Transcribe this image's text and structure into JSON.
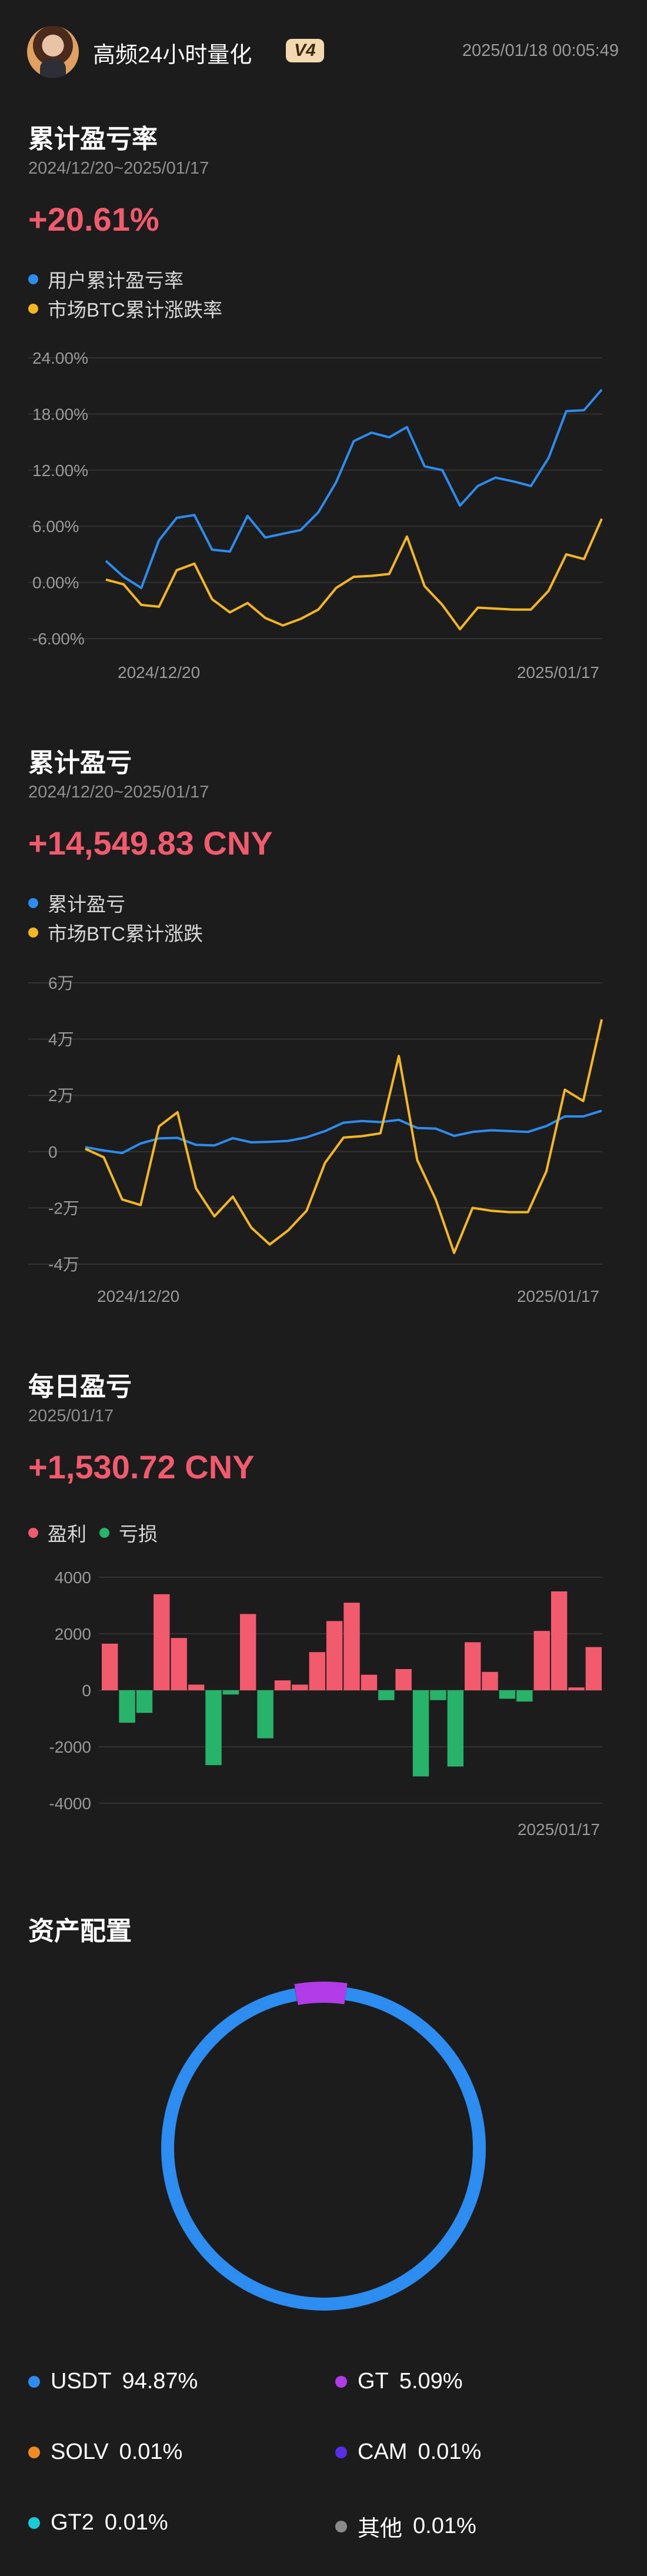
{
  "header": {
    "user_name": "高频24小时量化",
    "badge": "V4",
    "timestamp": "2025/01/18 00:05:49"
  },
  "colors": {
    "user": "#2d8cf0",
    "btc": "#f5b71f",
    "profit": "#f25a6e",
    "loss": "#27b36a",
    "grid": "#333333",
    "axis_text": "#9a9a9a"
  },
  "section_return": {
    "title": "累计盈亏率",
    "date_range": "2024/12/20~2025/01/17",
    "value": "+20.61%",
    "legend": [
      "用户累计盈亏率",
      "市场BTC累计涨跌率"
    ]
  },
  "section_pnl": {
    "title": "累计盈亏",
    "date_range": "2024/12/20~2025/01/17",
    "value": "+14,549.83 CNY",
    "legend": [
      "累计盈亏",
      "市场BTC累计涨跌"
    ]
  },
  "section_daily": {
    "title": "每日盈亏",
    "date": "2025/01/17",
    "value": "+1,530.72 CNY",
    "legend": [
      "盈利",
      "亏损"
    ]
  },
  "section_alloc": {
    "title": "资产配置",
    "items": [
      {
        "name": "USDT",
        "pct": "94.87%",
        "color": "#2d8cf0"
      },
      {
        "name": "GT",
        "pct": "5.09%",
        "color": "#b23be8"
      },
      {
        "name": "SOLV",
        "pct": "0.01%",
        "color": "#f08a24"
      },
      {
        "name": "CAM",
        "pct": "0.01%",
        "color": "#5a2de8"
      },
      {
        "name": "GT2",
        "pct": "0.01%",
        "color": "#19c9d6"
      },
      {
        "name": "其他",
        "pct": "0.01%",
        "color": "#8a8a8a"
      }
    ]
  },
  "chart_data": [
    {
      "type": "line",
      "title": "累计盈亏率",
      "x_start_label": "2024/12/20",
      "x_end_label": "2025/01/17",
      "yticks": [
        "24.00%",
        "18.00%",
        "12.00%",
        "6.00%",
        "0.00%",
        "-6.00%"
      ],
      "ylim": [
        -6,
        24
      ],
      "series": [
        {
          "name": "用户累计盈亏率",
          "color": "#2d8cf0",
          "values": [
            2.3,
            0.6,
            -0.6,
            4.5,
            6.9,
            7.2,
            3.5,
            3.3,
            7.1,
            4.8,
            5.2,
            5.6,
            7.5,
            10.7,
            15.1,
            16.0,
            15.5,
            16.6,
            12.4,
            12.0,
            8.2,
            10.3,
            11.2,
            10.8,
            10.3,
            13.3,
            18.3,
            18.4,
            20.6
          ]
        },
        {
          "name": "市场BTC累计涨跌率",
          "color": "#f5b71f",
          "values": [
            0.3,
            -0.2,
            -2.4,
            -2.6,
            1.3,
            2.0,
            -1.8,
            -3.2,
            -2.2,
            -3.8,
            -4.6,
            -3.9,
            -2.9,
            -0.6,
            0.6,
            0.7,
            0.9,
            4.9,
            -0.4,
            -2.4,
            -5.0,
            -2.7,
            -2.8,
            -2.9,
            -2.9,
            -0.9,
            3.0,
            2.5,
            6.8
          ]
        }
      ]
    },
    {
      "type": "line",
      "title": "累计盈亏",
      "x_start_label": "2024/12/20",
      "x_end_label": "2025/01/17",
      "yticks": [
        "6万",
        "4万",
        "2万",
        "0",
        "-2万",
        "-4万"
      ],
      "ylim": [
        -40000,
        60000
      ],
      "series": [
        {
          "name": "累计盈亏",
          "color": "#2d8cf0",
          "values": [
            1600,
            400,
            -500,
            2900,
            4700,
            4900,
            2400,
            2200,
            4800,
            3300,
            3500,
            3800,
            5100,
            7300,
            10300,
            10900,
            10500,
            11300,
            8400,
            8200,
            5600,
            7000,
            7600,
            7300,
            7000,
            9100,
            12500,
            12500,
            14550
          ]
        },
        {
          "name": "市场BTC累计涨跌",
          "color": "#f5b71f",
          "values": [
            1000,
            -2000,
            -17000,
            -19000,
            9000,
            14000,
            -13000,
            -23000,
            -16000,
            -27000,
            -33000,
            -28000,
            -21000,
            -4000,
            5000,
            5500,
            6500,
            34000,
            -3000,
            -17000,
            -36000,
            -20000,
            -21000,
            -21500,
            -21500,
            -7000,
            22000,
            18000,
            47000
          ]
        }
      ]
    },
    {
      "type": "bar",
      "title": "每日盈亏",
      "x_end_label": "2025/01/17",
      "yticks": [
        "4000",
        "2000",
        "0",
        "-2000",
        "-4000"
      ],
      "ylim": [
        -4000,
        4000
      ],
      "values": [
        1650,
        -1150,
        -800,
        3400,
        1850,
        200,
        -2650,
        -150,
        2700,
        -1700,
        350,
        200,
        1350,
        2450,
        3100,
        550,
        -350,
        750,
        -3050,
        -350,
        -2700,
        1700,
        650,
        -300,
        -400,
        2100,
        3500,
        100,
        1530
      ]
    },
    {
      "type": "pie",
      "title": "资产配置",
      "categories": [
        "USDT",
        "GT",
        "SOLV",
        "CAM",
        "GT2",
        "其他"
      ],
      "values": [
        94.87,
        5.09,
        0.01,
        0.01,
        0.01,
        0.01
      ]
    }
  ]
}
